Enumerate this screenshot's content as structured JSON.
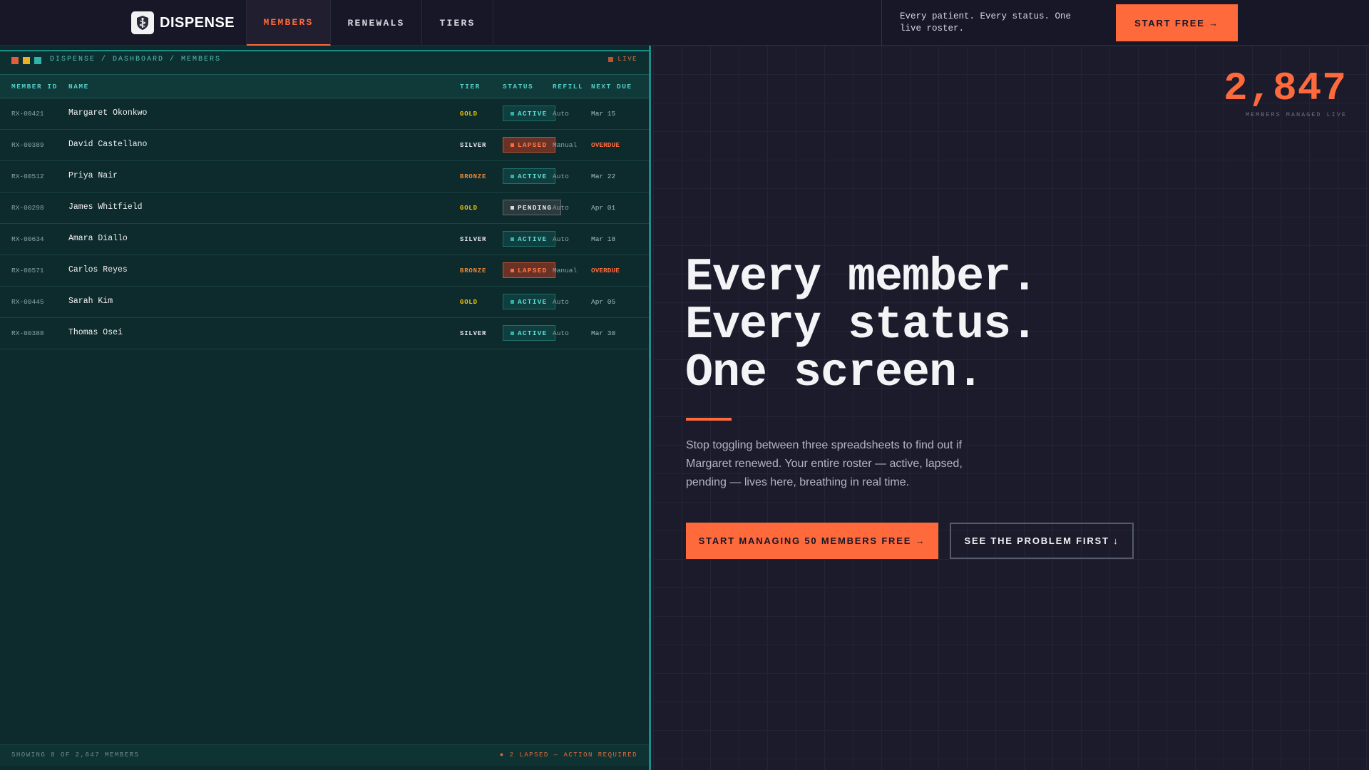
{
  "brand": {
    "name": "DISPENSE",
    "logo_icon": "shield-caduceus-icon"
  },
  "nav": {
    "tabs": [
      {
        "label": "MEMBERS",
        "active": true
      },
      {
        "label": "RENEWALS",
        "active": false
      },
      {
        "label": "TIERS",
        "active": false
      }
    ],
    "tagline": "Every patient. Every status. One live roster.",
    "cta": "START FREE →"
  },
  "dashboard": {
    "window_dot_colors": [
      "#e0603a",
      "#e8b323",
      "#2fb3aa"
    ],
    "breadcrumb": "DISPENSE / DASHBOARD / MEMBERS",
    "live_label": "LIVE",
    "columns": {
      "member_id": "MEMBER ID",
      "name": "NAME",
      "tier": "TIER",
      "status": "STATUS",
      "refill": "REFILL",
      "next_due": "NEXT DUE"
    },
    "rows": [
      {
        "id": "RX-00421",
        "name": "Margaret Okonkwo",
        "tier": "GOLD",
        "status": "ACTIVE",
        "refill": "Auto",
        "due": "Mar 15"
      },
      {
        "id": "RX-00389",
        "name": "David Castellano",
        "tier": "SILVER",
        "status": "LAPSED",
        "refill": "Manual",
        "due": "OVERDUE"
      },
      {
        "id": "RX-00512",
        "name": "Priya Nair",
        "tier": "BRONZE",
        "status": "ACTIVE",
        "refill": "Auto",
        "due": "Mar 22"
      },
      {
        "id": "RX-00298",
        "name": "James Whitfield",
        "tier": "GOLD",
        "status": "PENDING",
        "refill": "Auto",
        "due": "Apr 01"
      },
      {
        "id": "RX-00634",
        "name": "Amara Diallo",
        "tier": "SILVER",
        "status": "ACTIVE",
        "refill": "Auto",
        "due": "Mar 18"
      },
      {
        "id": "RX-00571",
        "name": "Carlos Reyes",
        "tier": "BRONZE",
        "status": "LAPSED",
        "refill": "Manual",
        "due": "OVERDUE"
      },
      {
        "id": "RX-00445",
        "name": "Sarah Kim",
        "tier": "GOLD",
        "status": "ACTIVE",
        "refill": "Auto",
        "due": "Apr 05"
      },
      {
        "id": "RX-00388",
        "name": "Thomas Osei",
        "tier": "SILVER",
        "status": "ACTIVE",
        "refill": "Auto",
        "due": "Mar 30"
      }
    ],
    "footer_left": "SHOWING 8 OF 2,847 MEMBERS",
    "footer_right": "● 2 LAPSED — ACTION REQUIRED"
  },
  "hero": {
    "counter_value": "2,847",
    "counter_label": "MEMBERS MANAGED LIVE",
    "headline": [
      "Every member.",
      "Every status.",
      "One screen."
    ],
    "subcopy": "Stop toggling between three spreadsheets to find out if Margaret renewed. Your entire roster — active, lapsed, pending — lives here, breathing in real time.",
    "primary_cta": "START MANAGING 50 MEMBERS FREE →",
    "secondary_cta": "SEE THE PROBLEM FIRST ↓"
  },
  "colors": {
    "accent": "#ff6a3d",
    "teal": "#2fb3aa",
    "gold": "#f5c400",
    "bronze": "#e58b3c",
    "panel_bg": "#0d2a2c",
    "page_bg": "#1b1b2b"
  }
}
